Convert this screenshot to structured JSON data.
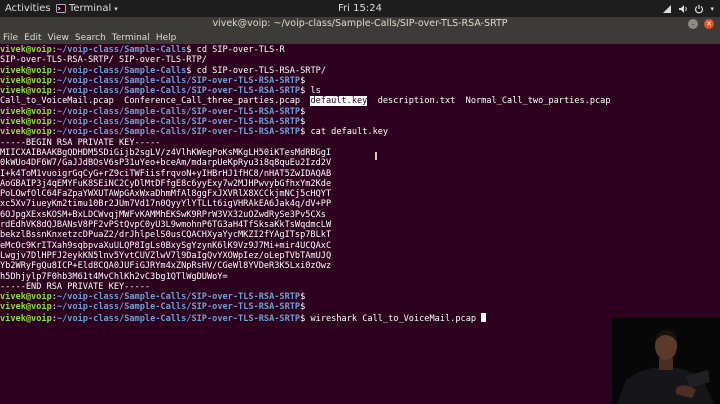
{
  "topbar": {
    "activities": "Activities",
    "app_name": "Terminal",
    "clock": "Fri 15:24",
    "colors": {
      "bar": "#1d1d1d"
    }
  },
  "window": {
    "title": "vivek@voip: ~/voip-class/Sample-Calls/SIP-over-TLS-RSA-SRTP",
    "menu": [
      "File",
      "Edit",
      "View",
      "Search",
      "Terminal",
      "Help"
    ]
  },
  "terminal": {
    "colors": {
      "background": "#2c001e",
      "user": "#8ae234",
      "path": "#729fcf"
    },
    "lines": [
      {
        "user": "vivek@voip",
        "path": "~/voip-class/Sample-Calls",
        "cmd": " cd SIP-over-TLS-R"
      },
      {
        "text": "SIP-over-TLS-RSA-SRTP/ SIP-over-TLS-RTP/"
      },
      {
        "user": "vivek@voip",
        "path": "~/voip-class/Sample-Calls",
        "cmd": " cd SIP-over-TLS-RSA-SRTP/"
      },
      {
        "user": "vivek@voip",
        "path": "~/voip-class/Sample-Calls/SIP-over-TLS-RSA-SRTP",
        "cmd": ""
      },
      {
        "user": "vivek@voip",
        "path": "~/voip-class/Sample-Calls/SIP-over-TLS-RSA-SRTP",
        "cmd": " ls"
      },
      {
        "pre": "Call_to_VoiceMail.pcap  Conference_Call_three_parties.pcap  ",
        "hl": "default.key",
        "post": "  description.txt  Normal_Call_two_parties.pcap"
      },
      {
        "user": "vivek@voip",
        "path": "~/voip-class/Sample-Calls/SIP-over-TLS-RSA-SRTP",
        "cmd": ""
      },
      {
        "user": "vivek@voip",
        "path": "~/voip-class/Sample-Calls/SIP-over-TLS-RSA-SRTP",
        "cmd": ""
      },
      {
        "user": "vivek@voip",
        "path": "~/voip-class/Sample-Calls/SIP-over-TLS-RSA-SRTP",
        "cmd": " cat default.key"
      },
      {
        "text": "-----BEGIN RSA PRIVATE KEY-----"
      },
      {
        "text": "MIICXAIBAAKBgQDHDM5SDiGijb2sgLV/z4VlhKWegPoKsMKgLH50iKTesMdRBGgI"
      },
      {
        "text": "0kWUo4DF6W7/GaJJdBOsV6sP31uYeo+bceAm/mdarpUeKpRyu3i8q8quEu2Izd2V"
      },
      {
        "text": "I+k4ToM1vuoigrGqCyG+rZ9ciTWFiisfrqvoN+yIHBrHJ1fHC8/nHAT5ZwIDAQAB"
      },
      {
        "text": "AoGBAIP3j4qEMYFuK8SEiNC2CyDlMtDFfgE8c6yyExy7w2MJHPwvybGfhxYm2Kde"
      },
      {
        "text": "PoLOwfOlC64FaZpaYWXUTAWpGAxWxaDhmMfAl8ggFxJXVRlX8XCCkjmNCj5cHQYT"
      },
      {
        "text": "xc5Xv7iueyKm2timu10Br2JUm7Vd17n0QyyYlYTLLt6igVHRAkEA6Jak4q/dV+PP"
      },
      {
        "text": "6OJpgXExsKOSM+BxLDCWvqjMWFvKAMMhEKSwK9RPrW3VX32uOZwdRySe3Pv5CXs"
      },
      {
        "text": "rdEdhVK8dQJBANsV8PF2vPStQvpC0yU3L9wmohnP6TG3aH4TfSksaKkTsWqdmcLW"
      },
      {
        "text": "bekzlBssnKnxetzcDPuaZ2/drJhlpelS0usCQACHXyaYycMKZI2fYAgITsp7BLkT"
      },
      {
        "text": "eMcOc9KrITXah9sqbpvaXuULQP8IgLs0BxySgYzynK6lK9Vz9J7Mi+mir4UCQAxC"
      },
      {
        "text": "Lwgjv7DlHPFJ2eykKN5lnv5YvtCUVZlwV7l9DaIgQvYXOWpIez/oLepTVbTAmUJQ"
      },
      {
        "text": "Yb2WRyFgQu8ICP+Eld8CQA0JUFiGJRYm4xZNpRsHV/CGeWl8YVDeR3K5Lxi0zOwz"
      },
      {
        "text": "h5Dhjylp7F0hb3M61t4MvChlKh2vC3bg1QTlWgDUWoY="
      },
      {
        "text": "-----END RSA PRIVATE KEY-----"
      },
      {
        "user": "vivek@voip",
        "path": "~/voip-class/Sample-Calls/SIP-over-TLS-RSA-SRTP",
        "cmd": ""
      },
      {
        "user": "vivek@voip",
        "path": "~/voip-class/Sample-Calls/SIP-over-TLS-RSA-SRTP",
        "cmd": ""
      },
      {
        "user": "vivek@voip",
        "path": "~/voip-class/Sample-Calls/SIP-over-TLS-RSA-SRTP",
        "cmd": " wireshark Call_to_VoiceMail.pcap ",
        "cursor": true
      }
    ]
  }
}
